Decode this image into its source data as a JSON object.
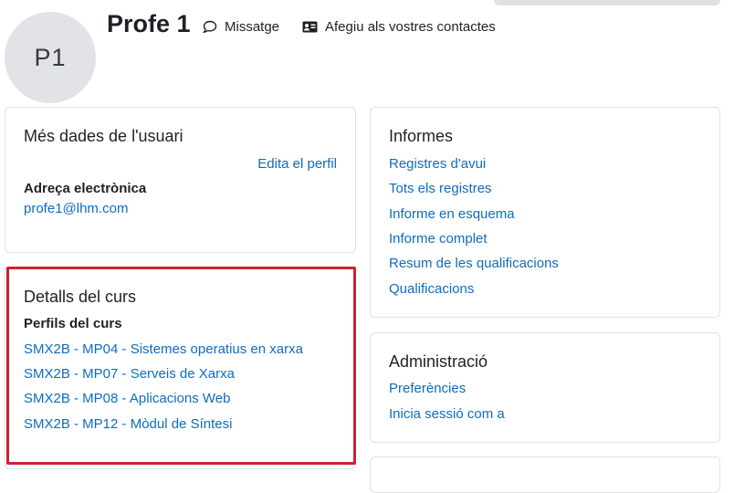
{
  "header": {
    "avatar_initials": "P1",
    "user_name": "Profe 1",
    "message_label": "Missatge",
    "add_contact_label": "Afegiu als vostres contactes"
  },
  "user_details": {
    "title": "Més dades de l'usuari",
    "edit_profile": "Edita el perfil",
    "email_label": "Adreça electrònica",
    "email_value": "profe1@lhm.com"
  },
  "course_details": {
    "title": "Detalls del curs",
    "profiles_label": "Perfils del curs",
    "courses": [
      "SMX2B - MP04 - Sistemes operatius en xarxa",
      "SMX2B - MP07 - Serveis de Xarxa",
      "SMX2B - MP08 - Aplicacions Web",
      "SMX2B - MP12 - Mòdul de Síntesi"
    ]
  },
  "reports": {
    "title": "Informes",
    "links": [
      "Registres d'avui",
      "Tots els registres",
      "Informe en esquema",
      "Informe complet",
      "Resum de les qualificacions",
      "Qualificacions"
    ]
  },
  "administration": {
    "title": "Administració",
    "links": [
      "Preferències",
      "Inicia sessió com a"
    ]
  },
  "colors": {
    "link": "#0f6cbf",
    "highlight": "#d0212b",
    "avatar_bg": "#e1e3e6"
  }
}
